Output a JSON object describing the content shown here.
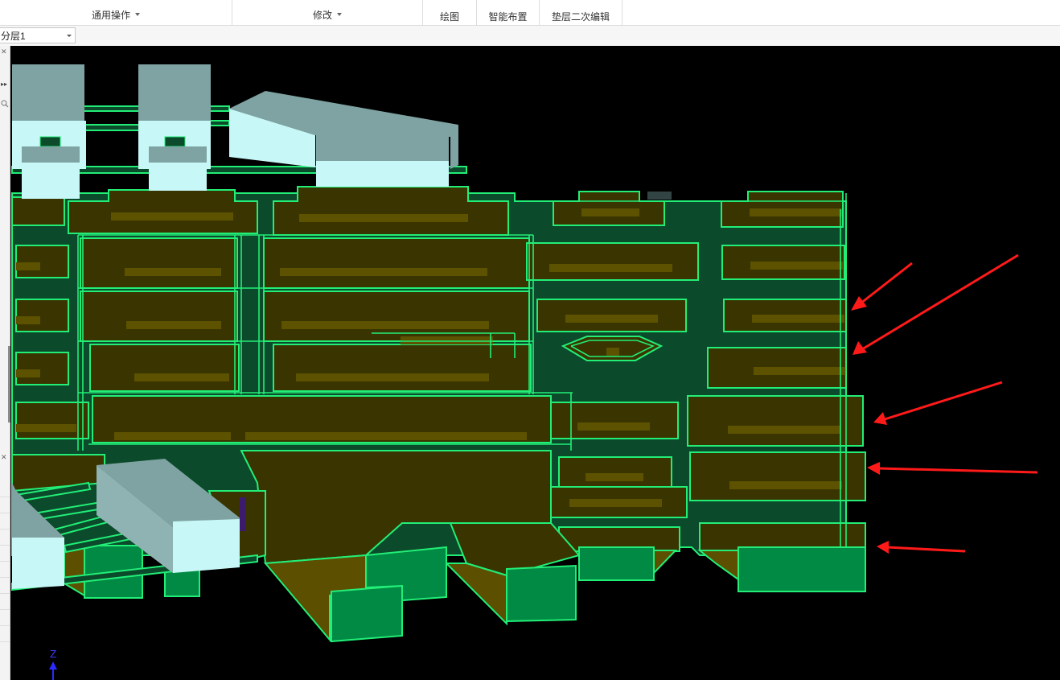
{
  "ribbon": {
    "groups": [
      {
        "label": "通用操作",
        "has_dropdown": true
      },
      {
        "label": "修改",
        "has_dropdown": true
      }
    ],
    "tabs": [
      {
        "label": "绘图"
      },
      {
        "label": "智能布置"
      },
      {
        "label": "垫层二次编辑"
      }
    ]
  },
  "layer_select": {
    "value": "分层1"
  },
  "viewport": {
    "background": "#000000",
    "axis_label": "Z",
    "colors": {
      "edge": "#22ee77",
      "slab": "#0b4a2a",
      "cushion": "#3a3500",
      "cushion_mark": "#5c5200",
      "pier": "#008a44",
      "block_top": "#7fa3a3",
      "block_front": "#c7f7f7",
      "arrow": "#ff1a1a"
    },
    "annotation_arrows": 5
  }
}
